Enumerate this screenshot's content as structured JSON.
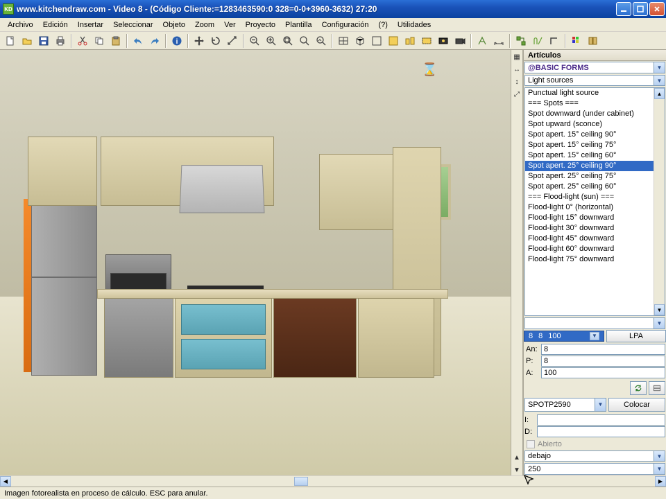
{
  "titlebar": {
    "app_icon_text": "KD",
    "text": "www.kitchendraw.com - Video 8 - (Código Cliente:=1283463590:0 328=0-0+3960-3632) 27:20"
  },
  "menu": [
    "Archivo",
    "Edición",
    "Insertar",
    "Seleccionar",
    "Objeto",
    "Zoom",
    "Ver",
    "Proyecto",
    "Plantilla",
    "Configuración",
    "(?)",
    "Utilidades"
  ],
  "panel": {
    "header": "Artículos",
    "category": "@BASIC FORMS",
    "subcategory": "Light sources",
    "items": [
      "Punctual light source",
      "=== Spots ===",
      "Spot downward (under cabinet)",
      "Spot upward (sconce)",
      "Spot apert. 15° ceiling 90°",
      "Spot apert. 15° ceiling 75°",
      "Spot apert. 15° ceiling 60°",
      "Spot apert. 25° ceiling 90°",
      "Spot apert. 25° ceiling 75°",
      "Spot apert. 25° ceiling 60°",
      "=== Flood-light (sun) ===",
      "Flood-light 0° (horizontal)",
      "Flood-light 15° downward",
      "Flood-light 30° downward",
      "Flood-light 45° downward",
      "Flood-light 60° downward",
      "Flood-light 75° downward"
    ],
    "selected_index": 7,
    "size_chip": [
      "8",
      "8",
      "100"
    ],
    "lpa_label": "LPA",
    "fields": {
      "an_label": "An:",
      "an": "8",
      "p_label": "P:",
      "p": "8",
      "a_label": "A:",
      "a": "100"
    },
    "ref_combo": "SPOTP2590",
    "place_label": "Colocar",
    "fields2": {
      "i_label": "I:",
      "i": "",
      "d_label": "D:",
      "d": ""
    },
    "open_label": "Abierto",
    "pos_combo": "debajo",
    "height_combo": "250"
  },
  "status": "Imagen fotorealista en proceso de cálculo. ESC para anular.",
  "cursor_glyph": "⌛"
}
